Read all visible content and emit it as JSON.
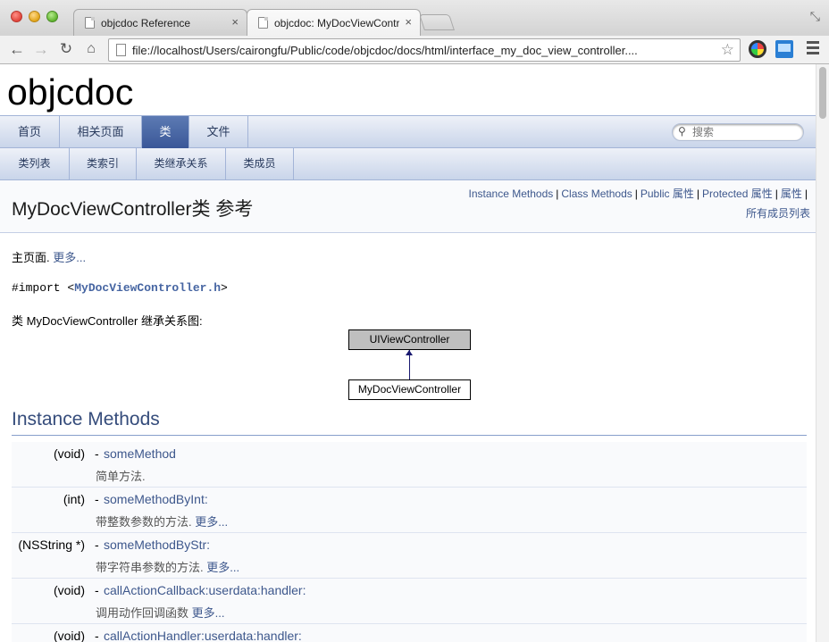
{
  "browser": {
    "tabs": [
      {
        "title": "objcdoc Reference",
        "active": false
      },
      {
        "title": "objcdoc: MyDocViewController",
        "active": true
      }
    ],
    "url": "file://localhost/Users/cairongfu/Public/code/objcdoc/docs/html/interface_my_doc_view_controller....",
    "tab_close_glyph": "×"
  },
  "page": {
    "project_name": "objcdoc",
    "nav_tabs": [
      "首页",
      "相关页面",
      "类",
      "文件"
    ],
    "nav_current": "类",
    "search_placeholder": "搜索",
    "sub_tabs": [
      "类列表",
      "类索引",
      "类继承关系",
      "类成员"
    ],
    "summary": {
      "links": [
        "Instance Methods",
        "Class Methods",
        "Public 属性",
        "Protected 属性",
        "属性"
      ],
      "all_members": "所有成员列表"
    },
    "title": "MyDocViewController类 参考",
    "brief_text": "主页面.",
    "more_label": "更多...",
    "import_prefix": "#import <",
    "import_file": "MyDocViewController.h",
    "import_suffix": ">",
    "inherit_title": "类 MyDocViewController 继承关系图:",
    "diagram": {
      "parent": "UIViewController",
      "child": "MyDocViewController"
    },
    "section_title": "Instance Methods",
    "methods": [
      {
        "type": "(void)",
        "name": "someMethod",
        "desc": "简单方法.",
        "more": ""
      },
      {
        "type": "(int)",
        "name": "someMethodByInt:",
        "desc": "带整数参数的方法.",
        "more": "更多..."
      },
      {
        "type": "(NSString *)",
        "name": "someMethodByStr:",
        "desc": "带字符串参数的方法.",
        "more": "更多..."
      },
      {
        "type": "(void)",
        "name": "callActionCallback:userdata:handler:",
        "desc": "调用动作回调函数",
        "more": "更多..."
      },
      {
        "type": "(void)",
        "name": "callActionHandler:userdata:handler:",
        "desc": "",
        "more": ""
      }
    ]
  }
}
